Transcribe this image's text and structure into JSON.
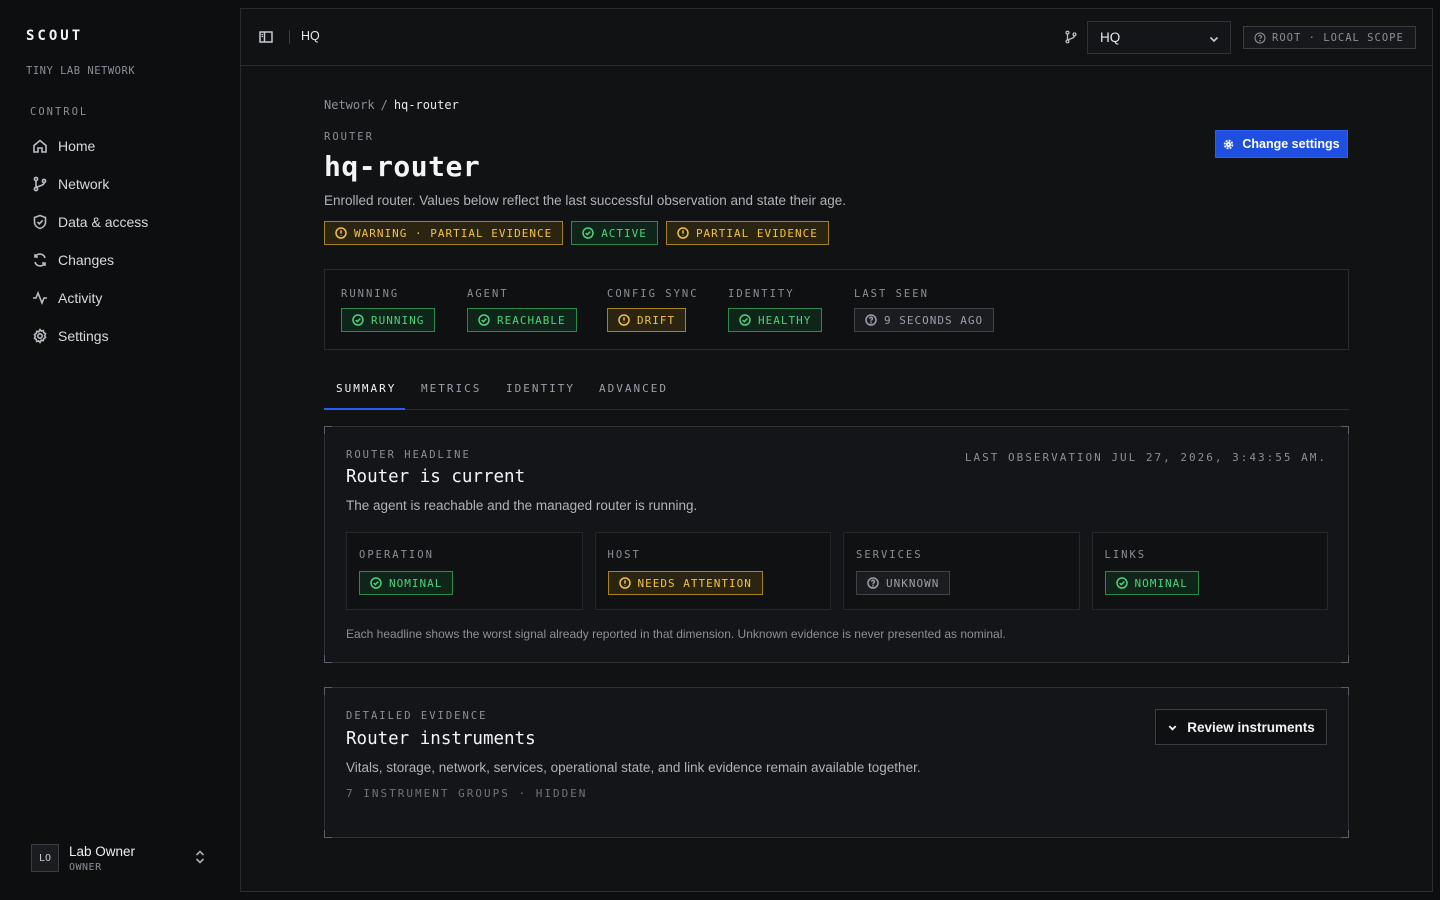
{
  "app": {
    "brand": "SCOUT",
    "subtitle": "TINY LAB NETWORK"
  },
  "sidebar": {
    "section_label": "CONTROL",
    "items": [
      {
        "label": "Home",
        "icon": "home-icon"
      },
      {
        "label": "Network",
        "icon": "branch-icon"
      },
      {
        "label": "Data & access",
        "icon": "shield-icon"
      },
      {
        "label": "Changes",
        "icon": "refresh-icon"
      },
      {
        "label": "Activity",
        "icon": "activity-icon"
      },
      {
        "label": "Settings",
        "icon": "gear-icon"
      }
    ],
    "user": {
      "initials": "LO",
      "name": "Lab Owner",
      "role": "OWNER"
    }
  },
  "topbar": {
    "title": "HQ",
    "site_select": "HQ",
    "scope_badge": "ROOT · LOCAL SCOPE"
  },
  "breadcrumb": {
    "parent": "Network",
    "separator": "/",
    "current": "hq-router"
  },
  "page": {
    "eyebrow": "ROUTER",
    "title": "hq-router",
    "description": "Enrolled router. Values below reflect the last successful observation and state their age.",
    "change_button": "Change settings",
    "badges": [
      {
        "label": "WARNING · PARTIAL EVIDENCE",
        "kind": "warn"
      },
      {
        "label": "ACTIVE",
        "kind": "ok"
      },
      {
        "label": "PARTIAL EVIDENCE",
        "kind": "warn"
      }
    ]
  },
  "status": {
    "running": {
      "label": "RUNNING",
      "value": "RUNNING",
      "kind": "ok"
    },
    "agent": {
      "label": "AGENT",
      "value": "REACHABLE",
      "kind": "ok"
    },
    "config_sync": {
      "label": "CONFIG SYNC",
      "value": "DRIFT",
      "kind": "warn"
    },
    "identity": {
      "label": "IDENTITY",
      "value": "HEALTHY",
      "kind": "ok"
    },
    "last_seen": {
      "label": "LAST SEEN",
      "value": "9 SECONDS AGO",
      "kind": "unknown"
    }
  },
  "tabs": [
    {
      "label": "SUMMARY",
      "active": true
    },
    {
      "label": "METRICS",
      "active": false
    },
    {
      "label": "IDENTITY",
      "active": false
    },
    {
      "label": "ADVANCED",
      "active": false
    }
  ],
  "headline": {
    "eyebrow": "ROUTER HEADLINE",
    "title": "Router is current",
    "description": "The agent is reachable and the managed router is running.",
    "last_observation": "LAST OBSERVATION JUL 27, 2026, 3:43:55 AM.",
    "dimensions": [
      {
        "label": "OPERATION",
        "value": "NOMINAL",
        "kind": "ok"
      },
      {
        "label": "HOST",
        "value": "NEEDS ATTENTION",
        "kind": "warn"
      },
      {
        "label": "SERVICES",
        "value": "UNKNOWN",
        "kind": "unknown"
      },
      {
        "label": "LINKS",
        "value": "NOMINAL",
        "kind": "ok"
      }
    ],
    "note": "Each headline shows the worst signal already reported in that dimension. Unknown evidence is never presented as nominal."
  },
  "evidence": {
    "eyebrow": "DETAILED EVIDENCE",
    "title": "Router instruments",
    "description": "Vitals, storage, network, services, operational state, and link evidence remain available together.",
    "meta": "7 INSTRUMENT GROUPS · HIDDEN",
    "review_button": "Review instruments"
  },
  "colors": {
    "accent": "#1f4fe0",
    "ok": "#4fd17c",
    "warn": "#f0c24a",
    "unknown": "#9ba0a8",
    "background": "#0d0e10"
  }
}
